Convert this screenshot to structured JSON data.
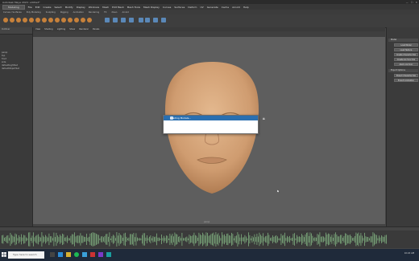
{
  "window": {
    "title": "Autodesk Maya 2020: untitled*"
  },
  "menubar": {
    "items": [
      "File",
      "Edit",
      "Create",
      "Select",
      "Modify",
      "Display",
      "Windows",
      "Mesh",
      "Edit Mesh",
      "Mesh Tools",
      "Mesh Display",
      "Curves",
      "Surfaces",
      "Deform",
      "UV",
      "Generate",
      "Cache",
      "Arnold",
      "Help"
    ],
    "workspace": "Modeling"
  },
  "shelf": {
    "tabs": [
      "Curves / Surfaces",
      "Poly Modeling",
      "Sculpting",
      "Rigging",
      "Animation",
      "Rendering",
      "FX",
      "XGen",
      "Arnold"
    ]
  },
  "outliner": {
    "header": "Outliner",
    "items": [
      "persp",
      "top",
      "front",
      "side",
      "defaultLightSet",
      "defaultObjectSet"
    ]
  },
  "viewport": {
    "menu": [
      "View",
      "Shading",
      "Lighting",
      "Show",
      "Renderer",
      "Panels"
    ],
    "camera_label": "persp"
  },
  "dialog": {
    "title": "Loading Models..."
  },
  "right_panel": {
    "section1": "Model",
    "buttons1": [
      "Load Model",
      "Load Texture",
      "Create Character Rig",
      "Create Lip Sync Rig",
      "Apply Lip Sync"
    ],
    "section2": "Export Options",
    "buttons2": [
      "Export Character Rig",
      "Export Animation"
    ]
  },
  "taskbar": {
    "search_placeholder": "Type here to search",
    "time": "10:24 AM"
  },
  "colors": {
    "accent": "#2a6fb0",
    "skin": "#d9a97c"
  }
}
